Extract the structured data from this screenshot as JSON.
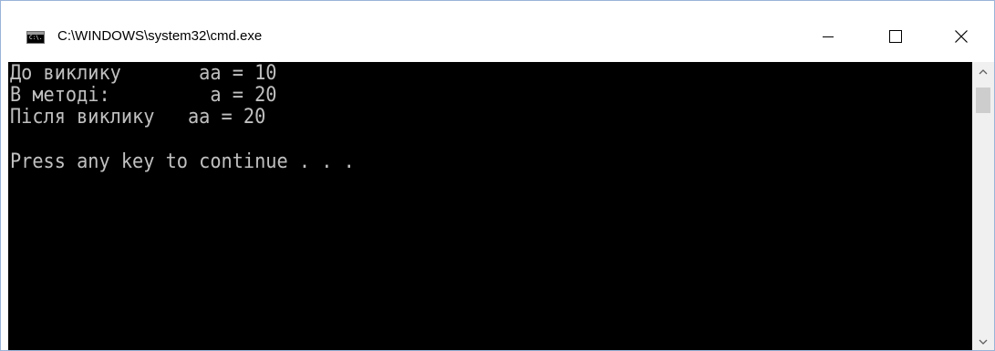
{
  "window": {
    "title": "C:\\WINDOWS\\system32\\cmd.exe",
    "icon": "cmd-icon",
    "icon_text": "C:\\."
  },
  "controls": {
    "minimize_icon": "minimize-icon",
    "maximize_icon": "maximize-icon",
    "close_icon": "close-icon"
  },
  "console": {
    "background": "#000000",
    "foreground": "#c0c0c0",
    "lines": [
      "До виклику       aa = 10",
      "В методі:         a = 20",
      "Після виклику   aa = 20",
      "Press any key to continue . . ."
    ]
  },
  "scrollbar": {
    "up_icon": "scroll-up-arrow-icon",
    "down_icon": "scroll-down-arrow-icon"
  }
}
